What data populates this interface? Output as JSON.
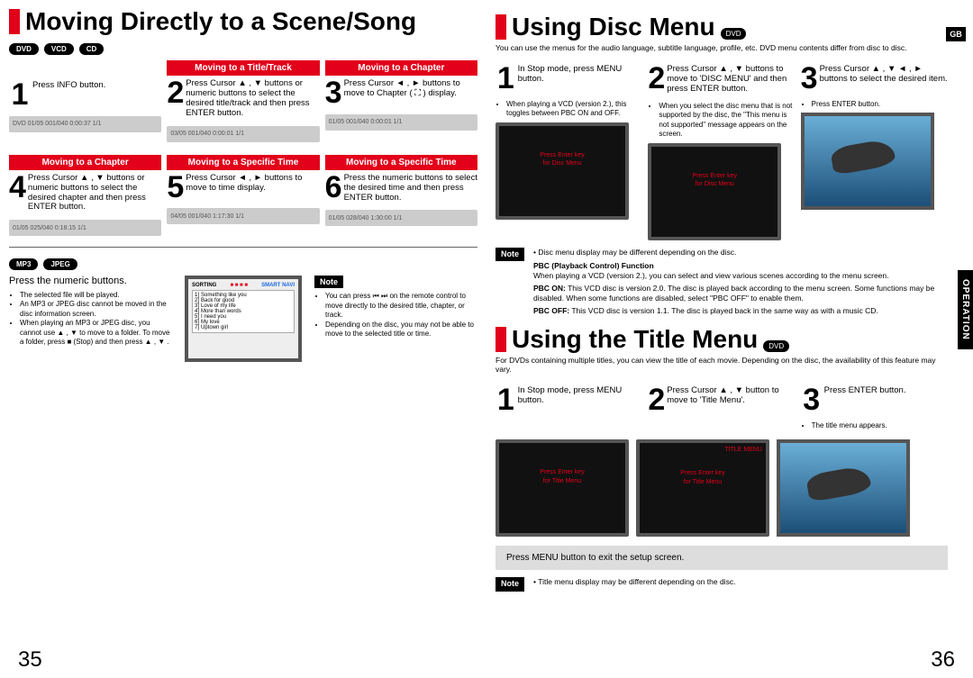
{
  "leftPage": {
    "title": "Moving Directly to a Scene/Song",
    "mediaBadgesTop": [
      "DVD",
      "VCD",
      "CD"
    ],
    "mediaBadgesMid": [
      "MP3",
      "JPEG"
    ],
    "row1": [
      {
        "num": "1",
        "text": "Press INFO button."
      },
      {
        "header": "Moving to a Title/Track",
        "num": "2",
        "text": "Press Cursor ▲ , ▼ buttons or numeric buttons to select the desired title/track and then press ENTER button."
      },
      {
        "header": "Moving to a Chapter",
        "num": "3",
        "text": "Press Cursor ◄ , ► buttons to move to Chapter ( ⛶ ) display."
      }
    ],
    "row2": [
      {
        "header": "Moving to a Chapter",
        "num": "4",
        "text": "Press Cursor ▲ , ▼ buttons or numeric buttons to select the desired chapter and then press ENTER button."
      },
      {
        "header": "Moving to a Specific Time",
        "num": "5",
        "text": "Press Cursor ◄ , ► buttons to move to time display."
      },
      {
        "header": "Moving to a Specific Time",
        "num": "6",
        "text": "Press the numeric buttons to select the desired time and then press ENTER button."
      }
    ],
    "numericText": "Press the numeric buttons.",
    "bullets": [
      "The selected file will be played.",
      "An MP3 or JPEG disc cannot be moved in the disc information screen.",
      "When playing an MP3 or JPEG disc, you cannot use ▲ , ▼ to move to a folder. To move a folder, press ■ (Stop) and then press ▲ , ▼ ."
    ],
    "noteLabel": "Note",
    "noteBullets": [
      "You can press ⏮ ⏭ on the remote control to move directly to the desired title, chapter, or track.",
      "Depending on the disc, you may not be able to move to the selected title or time."
    ],
    "sortMenu": {
      "heading1": "SORTING",
      "heading2": "SMART NAVI",
      "items": [
        "Something like you",
        "Back for good",
        "Love of my life",
        "More than words",
        "I need you",
        "My love",
        "Uptown girl"
      ]
    },
    "bars": {
      "bar1": "DVD  01/05  001/040  0:00:37  1/1",
      "bar2": "03/05  001/040  0:00:01  1/1",
      "bar3": "01/05  001/040  0:00:01  1/1",
      "bar4": "01/05  025/040  0:18:15  1/1",
      "bar5": "04/05  001/040  1:17:30  1/1",
      "bar6": "01/05  028/040  1:30:00  1/1"
    },
    "pageNum": "35"
  },
  "rightPage": {
    "gb": "GB",
    "sideTab": "OPERATION",
    "sec1": {
      "title": "Using Disc Menu",
      "disc": "DVD",
      "intro": "You can use the menus for the audio language, subtitle language, profile, etc. DVD menu contents differ from disc to disc.",
      "steps": [
        {
          "num": "1",
          "text": "In Stop mode, press MENU button."
        },
        {
          "num": "2",
          "text": "Press Cursor ▲ , ▼ buttons to move to 'DISC MENU' and then press ENTER button."
        },
        {
          "num": "3",
          "text": "Press Cursor ▲ , ▼ ◄ , ► buttons to select the desired item."
        }
      ],
      "subBullets": [
        "When playing a VCD (version 2.), this toggles between PBC ON and OFF.",
        "When you select the disc menu that is not supported by the disc, the \"This menu is not supported\" message appears on the screen.",
        "Press ENTER button."
      ],
      "tvText": [
        "Press Enter key",
        "for Disc Menu"
      ],
      "noteLabel": "Note",
      "noteHeading": "Disc menu display may be different depending on the disc.",
      "pbcTitle": "PBC (Playback Control) Function",
      "pbcIntro": "When playing a VCD (version 2.), you can select and view various scenes according to the menu screen.",
      "pbcOnLabel": "PBC ON:",
      "pbcOn": "This VCD disc is version 2.0. The disc is played back according to the menu screen. Some functions may be disabled. When some functions are disabled, select \"PBC OFF\" to enable them.",
      "pbcOffLabel": "PBC OFF:",
      "pbcOff": "This VCD disc is version 1.1. The disc is played back in the same way as with a music CD."
    },
    "sec2": {
      "title": "Using the Title Menu",
      "disc": "DVD",
      "intro": "For DVDs containing multiple titles, you can view the title of each movie. Depending on the disc, the availability of this feature may vary.",
      "steps": [
        {
          "num": "1",
          "text": "In Stop mode, press MENU button."
        },
        {
          "num": "2",
          "text": "Press Cursor ▲ , ▼ button to move to 'Title Menu'."
        },
        {
          "num": "3",
          "text": "Press ENTER button."
        }
      ],
      "bullet3": "The title menu appears.",
      "tvText": [
        "Press Enter key",
        "for Title Menu"
      ],
      "tvHeader": "TITLE MENU",
      "exitStrip": "Press MENU button to exit the setup screen.",
      "noteLabel": "Note",
      "noteText": "Title menu display may be different depending on the disc."
    },
    "pageNum": "36"
  }
}
